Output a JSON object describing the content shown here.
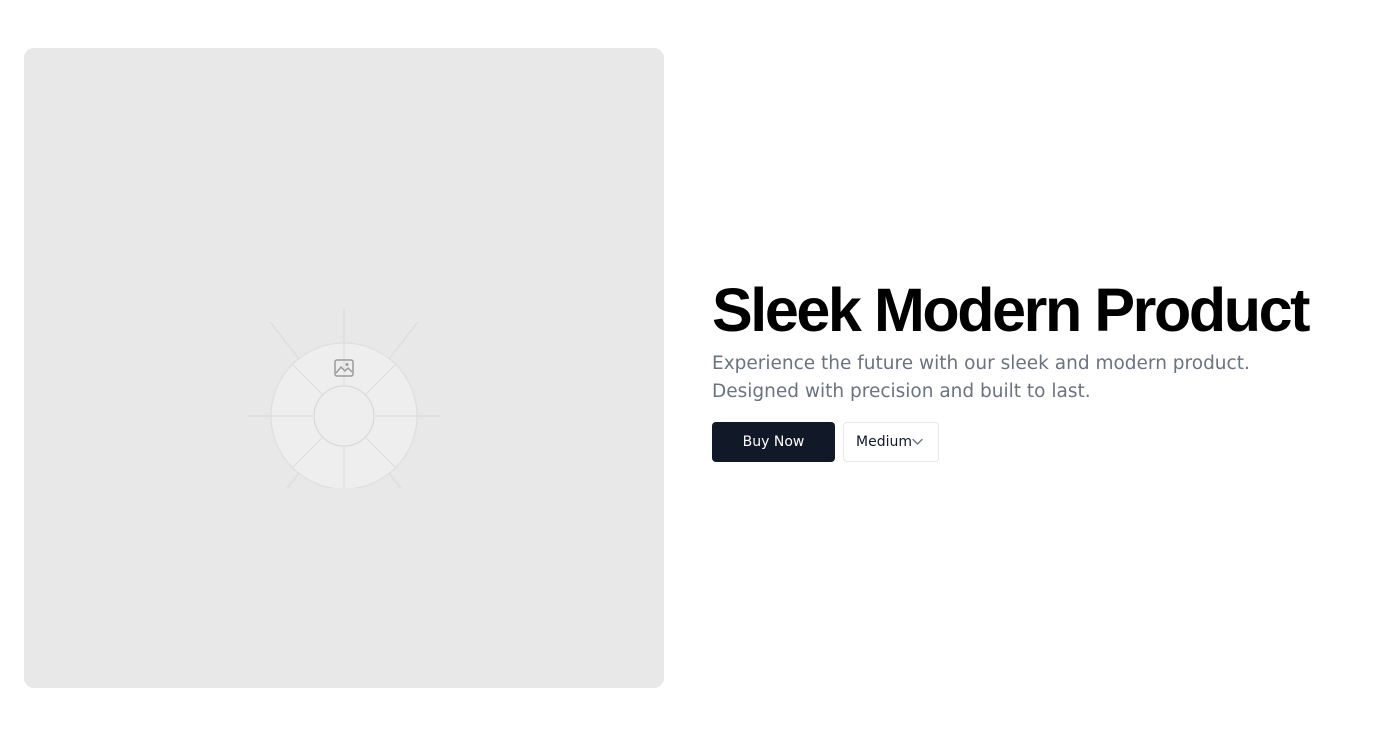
{
  "hero": {
    "image_placeholder_icon": "image-icon",
    "title": "Sleek Modern Product",
    "description": "Experience the future with our sleek and modern product. Designed with precision and built to last.",
    "buy_label": "Buy Now",
    "size_selected": "Medium",
    "size_icon": "chevron-down-icon"
  },
  "colors": {
    "image_panel_bg": "#e8e8e8",
    "title": "#000000",
    "description": "#6b7280",
    "primary_button_bg": "#111827",
    "primary_button_text": "#ffffff",
    "select_border": "#e5e7eb"
  }
}
